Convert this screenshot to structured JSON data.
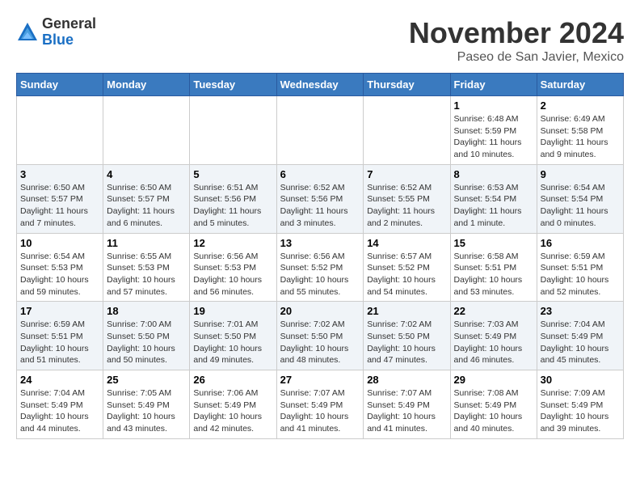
{
  "header": {
    "logo_general": "General",
    "logo_blue": "Blue",
    "month_title": "November 2024",
    "location": "Paseo de San Javier, Mexico"
  },
  "days_of_week": [
    "Sunday",
    "Monday",
    "Tuesday",
    "Wednesday",
    "Thursday",
    "Friday",
    "Saturday"
  ],
  "weeks": [
    [
      {
        "day": "",
        "info": ""
      },
      {
        "day": "",
        "info": ""
      },
      {
        "day": "",
        "info": ""
      },
      {
        "day": "",
        "info": ""
      },
      {
        "day": "",
        "info": ""
      },
      {
        "day": "1",
        "info": "Sunrise: 6:48 AM\nSunset: 5:59 PM\nDaylight: 11 hours and 10 minutes."
      },
      {
        "day": "2",
        "info": "Sunrise: 6:49 AM\nSunset: 5:58 PM\nDaylight: 11 hours and 9 minutes."
      }
    ],
    [
      {
        "day": "3",
        "info": "Sunrise: 6:50 AM\nSunset: 5:57 PM\nDaylight: 11 hours and 7 minutes."
      },
      {
        "day": "4",
        "info": "Sunrise: 6:50 AM\nSunset: 5:57 PM\nDaylight: 11 hours and 6 minutes."
      },
      {
        "day": "5",
        "info": "Sunrise: 6:51 AM\nSunset: 5:56 PM\nDaylight: 11 hours and 5 minutes."
      },
      {
        "day": "6",
        "info": "Sunrise: 6:52 AM\nSunset: 5:56 PM\nDaylight: 11 hours and 3 minutes."
      },
      {
        "day": "7",
        "info": "Sunrise: 6:52 AM\nSunset: 5:55 PM\nDaylight: 11 hours and 2 minutes."
      },
      {
        "day": "8",
        "info": "Sunrise: 6:53 AM\nSunset: 5:54 PM\nDaylight: 11 hours and 1 minute."
      },
      {
        "day": "9",
        "info": "Sunrise: 6:54 AM\nSunset: 5:54 PM\nDaylight: 11 hours and 0 minutes."
      }
    ],
    [
      {
        "day": "10",
        "info": "Sunrise: 6:54 AM\nSunset: 5:53 PM\nDaylight: 10 hours and 59 minutes."
      },
      {
        "day": "11",
        "info": "Sunrise: 6:55 AM\nSunset: 5:53 PM\nDaylight: 10 hours and 57 minutes."
      },
      {
        "day": "12",
        "info": "Sunrise: 6:56 AM\nSunset: 5:53 PM\nDaylight: 10 hours and 56 minutes."
      },
      {
        "day": "13",
        "info": "Sunrise: 6:56 AM\nSunset: 5:52 PM\nDaylight: 10 hours and 55 minutes."
      },
      {
        "day": "14",
        "info": "Sunrise: 6:57 AM\nSunset: 5:52 PM\nDaylight: 10 hours and 54 minutes."
      },
      {
        "day": "15",
        "info": "Sunrise: 6:58 AM\nSunset: 5:51 PM\nDaylight: 10 hours and 53 minutes."
      },
      {
        "day": "16",
        "info": "Sunrise: 6:59 AM\nSunset: 5:51 PM\nDaylight: 10 hours and 52 minutes."
      }
    ],
    [
      {
        "day": "17",
        "info": "Sunrise: 6:59 AM\nSunset: 5:51 PM\nDaylight: 10 hours and 51 minutes."
      },
      {
        "day": "18",
        "info": "Sunrise: 7:00 AM\nSunset: 5:50 PM\nDaylight: 10 hours and 50 minutes."
      },
      {
        "day": "19",
        "info": "Sunrise: 7:01 AM\nSunset: 5:50 PM\nDaylight: 10 hours and 49 minutes."
      },
      {
        "day": "20",
        "info": "Sunrise: 7:02 AM\nSunset: 5:50 PM\nDaylight: 10 hours and 48 minutes."
      },
      {
        "day": "21",
        "info": "Sunrise: 7:02 AM\nSunset: 5:50 PM\nDaylight: 10 hours and 47 minutes."
      },
      {
        "day": "22",
        "info": "Sunrise: 7:03 AM\nSunset: 5:49 PM\nDaylight: 10 hours and 46 minutes."
      },
      {
        "day": "23",
        "info": "Sunrise: 7:04 AM\nSunset: 5:49 PM\nDaylight: 10 hours and 45 minutes."
      }
    ],
    [
      {
        "day": "24",
        "info": "Sunrise: 7:04 AM\nSunset: 5:49 PM\nDaylight: 10 hours and 44 minutes."
      },
      {
        "day": "25",
        "info": "Sunrise: 7:05 AM\nSunset: 5:49 PM\nDaylight: 10 hours and 43 minutes."
      },
      {
        "day": "26",
        "info": "Sunrise: 7:06 AM\nSunset: 5:49 PM\nDaylight: 10 hours and 42 minutes."
      },
      {
        "day": "27",
        "info": "Sunrise: 7:07 AM\nSunset: 5:49 PM\nDaylight: 10 hours and 41 minutes."
      },
      {
        "day": "28",
        "info": "Sunrise: 7:07 AM\nSunset: 5:49 PM\nDaylight: 10 hours and 41 minutes."
      },
      {
        "day": "29",
        "info": "Sunrise: 7:08 AM\nSunset: 5:49 PM\nDaylight: 10 hours and 40 minutes."
      },
      {
        "day": "30",
        "info": "Sunrise: 7:09 AM\nSunset: 5:49 PM\nDaylight: 10 hours and 39 minutes."
      }
    ]
  ]
}
